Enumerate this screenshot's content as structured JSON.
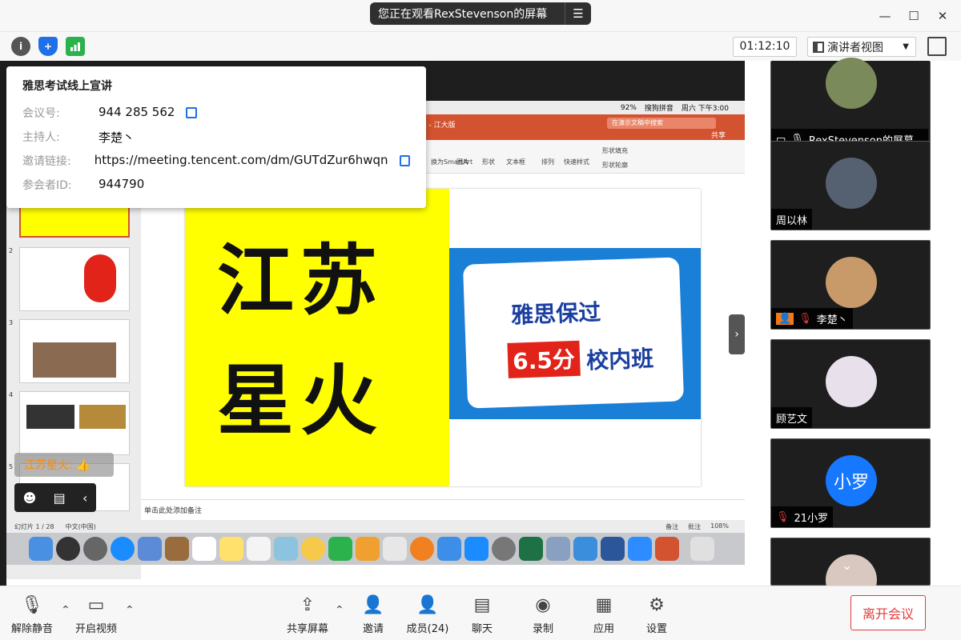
{
  "titlebar": {
    "sharing_banner": "您正在观看RexStevenson的屏幕",
    "menu_icon": "list-icon"
  },
  "infobar": {
    "timer": "01:12:10",
    "view_label": "演讲者视图"
  },
  "meeting_info": {
    "title": "雅思考试线上宣讲",
    "id_label": "会议号:",
    "id_value": "944 285 562",
    "host_label": "主持人:",
    "host_value": "李楚丶",
    "link_label": "邀请链接:",
    "link_value": "https://meeting.tencent.com/dm/GUTdZur6hwqn",
    "pid_label": "参会者ID:",
    "pid_value": "944790"
  },
  "shared_screen": {
    "menubar": {
      "battery": "92%",
      "input": "搜狗拼音",
      "time": "周六 下午3:00"
    },
    "ppt": {
      "doc_title": "s - 江大版",
      "search_placeholder": "在演示文稿中搜索",
      "share": "共享"
    },
    "ribbon": [
      "换为SmartArt",
      "图片",
      "形状",
      "文本框",
      "排列",
      "快速样式",
      "形状填充",
      "形状轮廓"
    ],
    "thumbnails": [
      "2",
      "3",
      "4",
      "5"
    ],
    "slide": {
      "big_text_line1": "江苏",
      "big_text_line2": "星火",
      "card_line1": "雅思保过",
      "badge": "6.5分",
      "card_line2": "校内班"
    },
    "notes_placeholder": "单击此处添加备注",
    "status_left": "幻灯片 1 / 28",
    "status_lang": "中文(中国)",
    "status_notes": "备注",
    "status_comments": "批注",
    "zoom": "108%"
  },
  "reaction": {
    "text": "江苏星火:",
    "emoji": "👍"
  },
  "participants": [
    {
      "name": "RexStevenson的屏幕...",
      "mic": "on"
    },
    {
      "name": "周以林",
      "mic": "none"
    },
    {
      "name": "李楚丶",
      "mic": "off",
      "host": true
    },
    {
      "name": "顾艺文",
      "mic": "none"
    },
    {
      "name": "21小罗",
      "mic": "off",
      "avatar_text": "小罗"
    }
  ],
  "toolbar": {
    "unmute": "解除静音",
    "video": "开启视频",
    "share": "共享屏幕",
    "invite": "邀请",
    "members": "成员(24)",
    "chat": "聊天",
    "record": "录制",
    "apps": "应用",
    "settings": "设置",
    "leave": "离开会议"
  },
  "colors": {
    "accent": "#1e6fe8",
    "danger": "#e03b3b",
    "ppt": "#d35230"
  }
}
